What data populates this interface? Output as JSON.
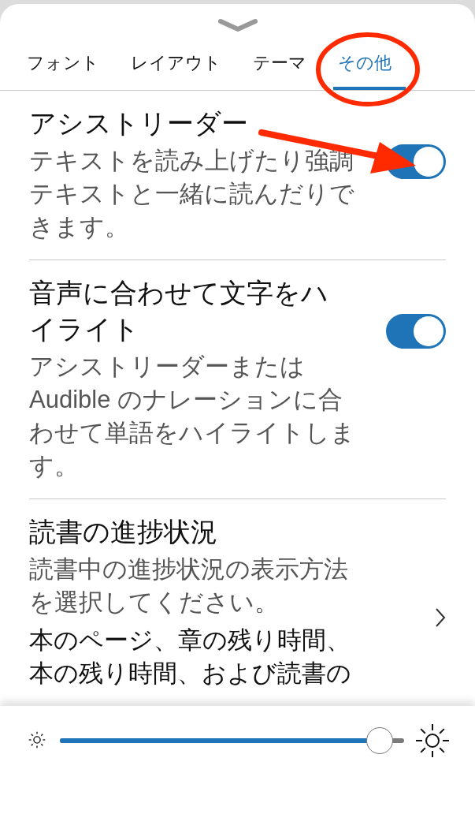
{
  "tabs": [
    {
      "label": "フォント",
      "selected": false
    },
    {
      "label": "レイアウト",
      "selected": false
    },
    {
      "label": "テーマ",
      "selected": false
    },
    {
      "label": "その他",
      "selected": true
    }
  ],
  "settings": [
    {
      "kind": "toggle",
      "title": "アシストリーダー",
      "description": "テキストを読み上げたり強調テキストと一緒に読んだりできます。",
      "on": true
    },
    {
      "kind": "toggle",
      "title": "音声に合わせて文字をハイライト",
      "description": "アシストリーダーまたは Audible のナレーションに合わせて単語をハイライトします。",
      "on": true
    },
    {
      "kind": "link",
      "title": "読書の進捗状況",
      "description": "読書中の進捗状況の表示方法を選択してください。",
      "detail": "本のページ、章の残り時間、本の残り時間、および読書の"
    }
  ],
  "brightness": {
    "level": 0.93
  }
}
